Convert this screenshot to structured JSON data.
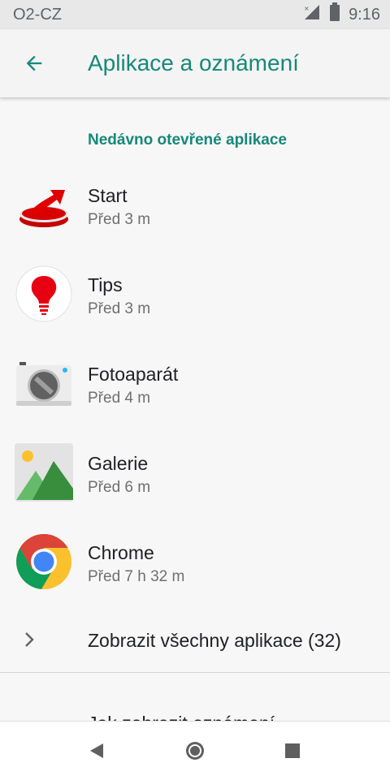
{
  "status_bar": {
    "carrier": "O2-CZ",
    "time": "9:16"
  },
  "app_bar": {
    "title": "Aplikace a oznámení"
  },
  "recent": {
    "header": "Nedávno otevřené aplikace",
    "apps": [
      {
        "name": "Start",
        "time": "Před 3 m",
        "icon": "start-icon"
      },
      {
        "name": "Tips",
        "time": "Před 3 m",
        "icon": "tips-icon"
      },
      {
        "name": "Fotoaparát",
        "time": "Před 4 m",
        "icon": "camera-icon"
      },
      {
        "name": "Galerie",
        "time": "Před 6 m",
        "icon": "gallery-icon"
      },
      {
        "name": "Chrome",
        "time": "Před 7 h 32 m",
        "icon": "chrome-icon"
      }
    ]
  },
  "see_all": {
    "label": "Zobrazit všechny aplikace (32)"
  },
  "next_section": {
    "label": "Jak zobrazit oznámení"
  },
  "colors": {
    "accent": "#16887a",
    "status_bg": "#e8e8e8",
    "background": "#f7f7f7"
  }
}
